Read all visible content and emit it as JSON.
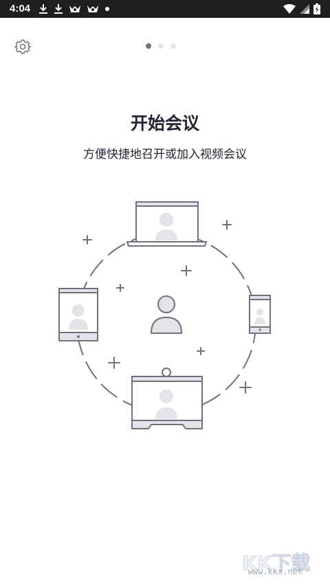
{
  "status_bar": {
    "time": "4:04",
    "left_icons": [
      "download-icon",
      "download-icon",
      "app-icon",
      "app-icon",
      "dot-icon"
    ],
    "right_icons": [
      "wifi-icon",
      "cell-signal-icon",
      "battery-icon"
    ]
  },
  "header": {
    "settings_icon": "gear-icon",
    "pager": {
      "total": 3,
      "active_index": 0
    }
  },
  "main": {
    "title": "开始会议",
    "subtitle": "方便快捷地召开或加入视频会议"
  },
  "watermark": {
    "logo_text": "KK下载",
    "url": "www.kkx.net"
  },
  "colors": {
    "text": "#232333",
    "illustration_line": "#6f6f7d",
    "illustration_fill": "#e3e3e9",
    "status_bar_bg": "#1f1f1f"
  }
}
